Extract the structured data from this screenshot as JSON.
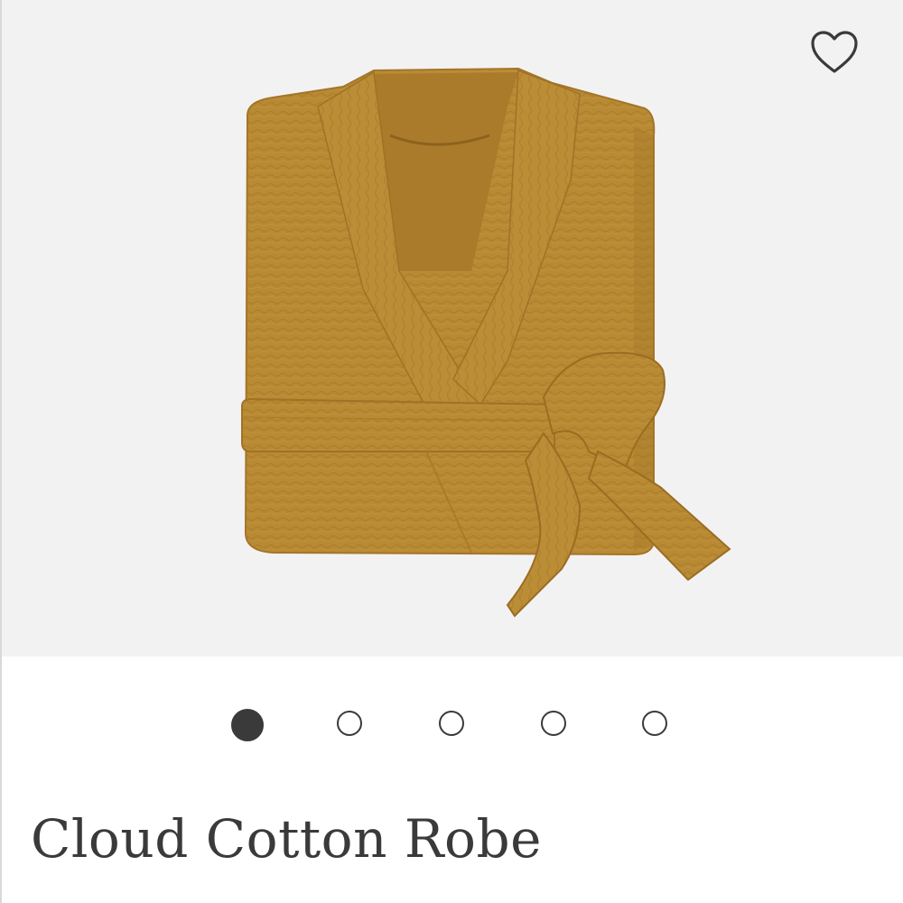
{
  "product": {
    "title": "Cloud Cotton Robe",
    "color": "#b88a34"
  },
  "gallery": {
    "total_images": 5,
    "active_index": 0
  },
  "favorite": {
    "icon": "heart-outline-icon"
  },
  "colors": {
    "background": "#f3f2f3",
    "text": "#3a3a3a"
  }
}
